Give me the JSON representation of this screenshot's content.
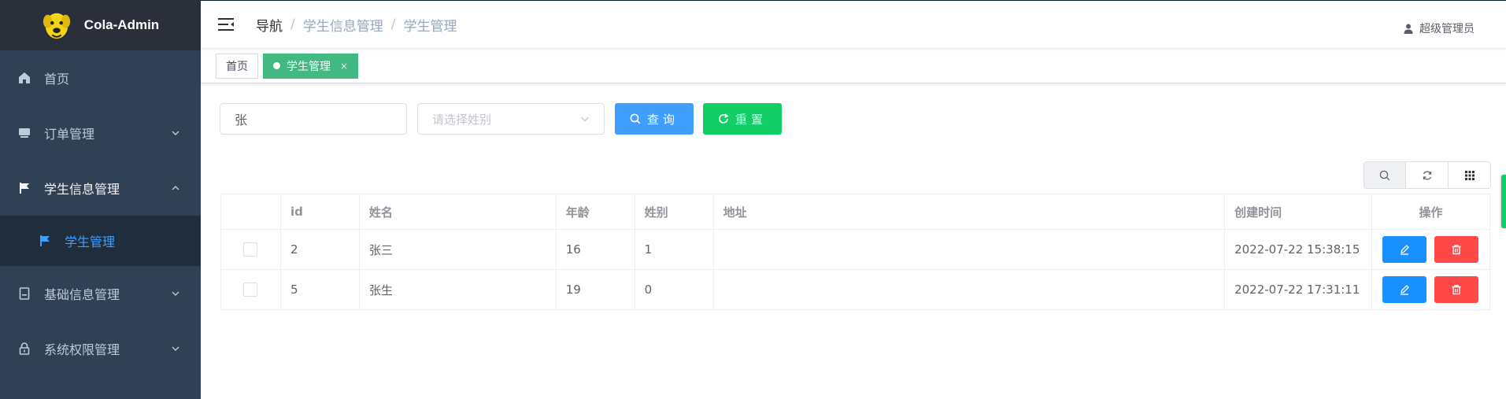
{
  "app": {
    "name": "Cola-Admin"
  },
  "sidebar": {
    "items": [
      {
        "label": "首页",
        "icon": "home-icon"
      },
      {
        "label": "订单管理",
        "icon": "order-icon"
      },
      {
        "label": "学生信息管理",
        "icon": "flag-icon",
        "expanded": true
      },
      {
        "label": "学生管理",
        "icon": "flag-icon",
        "active": true
      },
      {
        "label": "基础信息管理",
        "icon": "document-icon"
      },
      {
        "label": "系统权限管理",
        "icon": "lock-icon"
      }
    ]
  },
  "header": {
    "breadcrumb": [
      "导航",
      "学生信息管理",
      "学生管理"
    ],
    "user": "超级管理员"
  },
  "tags": {
    "items": [
      {
        "label": "首页"
      },
      {
        "label": "学生管理",
        "active": true,
        "close": "×"
      }
    ]
  },
  "search": {
    "name_value": "张",
    "gender_placeholder": "请选择姓别",
    "query_label": "查询",
    "reset_label": "重置"
  },
  "table": {
    "columns": [
      "",
      "id",
      "姓名",
      "年龄",
      "姓别",
      "地址",
      "创建时间",
      "操作"
    ],
    "rows": [
      {
        "id": "2",
        "name": "张三",
        "age": "16",
        "gender": "1",
        "address": "",
        "created": "2022-07-22 15:38:15"
      },
      {
        "id": "5",
        "name": "张生",
        "age": "19",
        "gender": "0",
        "address": "",
        "created": "2022-07-22 17:31:11"
      }
    ]
  },
  "colors": {
    "sidebar_bg": "#304156",
    "accent": "#409eff",
    "success": "#13ce66",
    "danger": "#ff4949",
    "tag_active": "#42b983"
  }
}
